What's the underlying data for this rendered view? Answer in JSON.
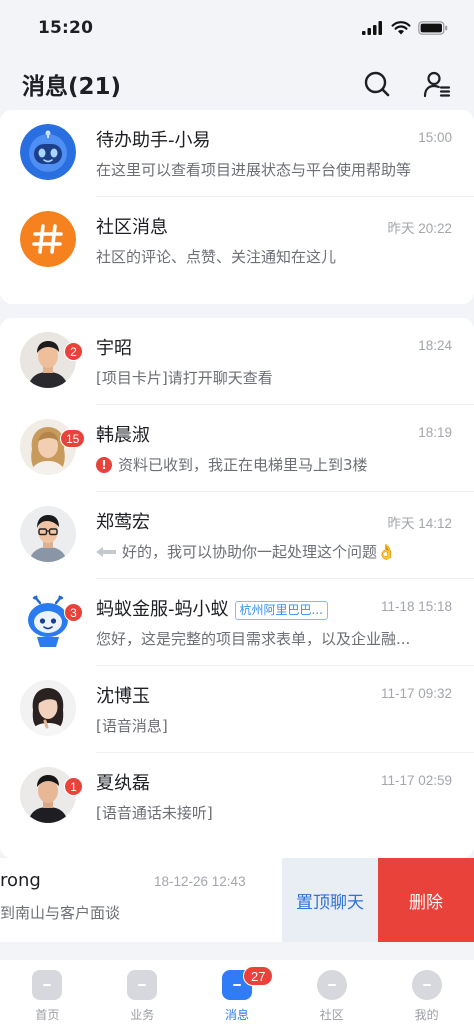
{
  "status_bar": {
    "time": "15:20"
  },
  "header": {
    "title": "消息(21)"
  },
  "pinned": [
    {
      "name": "待办助手-小易",
      "time": "15:00",
      "preview": "在这里可以查看项目进展状态与平台使用帮助等",
      "icon": "robot-icon"
    },
    {
      "name": "社区消息",
      "time": "昨天 20:22",
      "preview": "社区的评论、点赞、关注通知在这儿",
      "icon": "hash-icon"
    }
  ],
  "chats": [
    {
      "name": "宇昭",
      "time": "18:24",
      "preview": "[项目卡片]请打开聊天查看",
      "badge": "2"
    },
    {
      "name": "韩晨淑",
      "time": "18:19",
      "preview": "资料已收到，我正在电梯里马上到3楼",
      "badge": "15",
      "alert": "!"
    },
    {
      "name": "郑莺宏",
      "time": "昨天 14:12",
      "preview": "好的，我可以协助你一起处理这个问题👌"
    },
    {
      "name": "蚂蚁金服-蚂小蚁",
      "tag": "杭州阿里巴巴...",
      "time": "11-18 15:18",
      "preview": "您好，这是完整的项目需求表单，以及企业融...",
      "badge": "3"
    },
    {
      "name": "沈博玉",
      "time": "11-17 09:32",
      "preview": "[语音消息]"
    },
    {
      "name": "夏纨磊",
      "time": "11-17 02:59",
      "preview": "[语音通话未接听]",
      "badge": "1"
    }
  ],
  "swiped": {
    "name": "rong",
    "time": "18-12-26 12:43",
    "preview": "到南山与客户面谈",
    "pin_label": "置顶聊天",
    "delete_label": "删除"
  },
  "tabs": [
    {
      "label": "首页"
    },
    {
      "label": "业务"
    },
    {
      "label": "消息",
      "badge": "27"
    },
    {
      "label": "社区"
    },
    {
      "label": "我的"
    }
  ],
  "colors": {
    "accent": "#2f7cf6",
    "danger": "#e9423a",
    "community_orange": "#f5821f",
    "robot_blue": "#2a6fe0"
  }
}
